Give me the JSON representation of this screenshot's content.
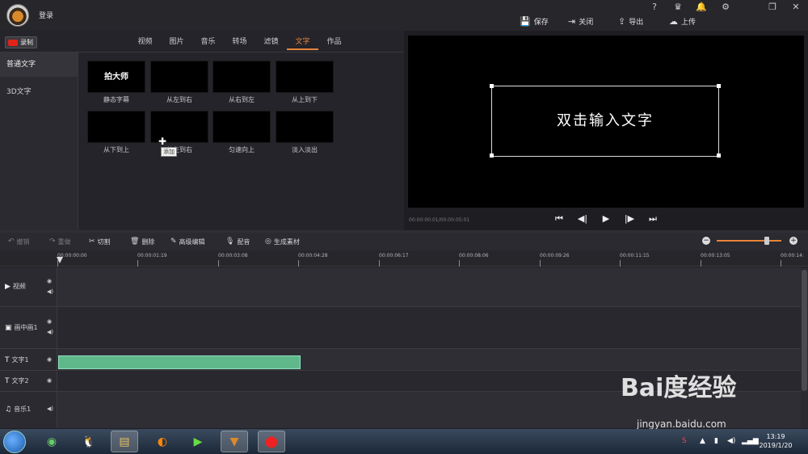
{
  "header": {
    "login_label": "登录",
    "buttons": {
      "save": "保存",
      "close": "关闭",
      "export": "导出",
      "upload": "上传"
    },
    "top_icons": [
      "help-icon",
      "vip-crown-icon",
      "notification-icon",
      "settings-icon",
      "restore-icon",
      "close-icon"
    ]
  },
  "record": {
    "label": "录制"
  },
  "tabs": [
    {
      "label": "视频",
      "active": false
    },
    {
      "label": "图片",
      "active": false
    },
    {
      "label": "音乐",
      "active": false
    },
    {
      "label": "转场",
      "active": false
    },
    {
      "label": "滤镜",
      "active": false
    },
    {
      "label": "文字",
      "active": true
    },
    {
      "label": "作品",
      "active": false
    }
  ],
  "categories": [
    {
      "label": "普通文字",
      "active": true
    },
    {
      "label": "3D文字",
      "active": false
    }
  ],
  "effects": [
    {
      "label": "静态字幕",
      "thumb_text": "拍大师"
    },
    {
      "label": "从左到右",
      "thumb_text": ""
    },
    {
      "label": "从右到左",
      "thumb_text": ""
    },
    {
      "label": "从上到下",
      "thumb_text": ""
    },
    {
      "label": "从下到上",
      "thumb_text": ""
    },
    {
      "label": "从左到右",
      "thumb_text": ""
    },
    {
      "label": "匀速向上",
      "thumb_text": ""
    },
    {
      "label": "淡入淡出",
      "thumb_text": ""
    }
  ],
  "tooltip": "添加",
  "preview": {
    "text": "双击输入文字",
    "timecode": "00:00:00:01/00:00:05:01"
  },
  "toolbar": {
    "undo": "撤销",
    "redo": "重做",
    "cut": "切割",
    "delete": "删除",
    "advanced_edit": "高级编辑",
    "dub": "配音",
    "generate": "生成素材"
  },
  "zoom_level": 0.78,
  "ruler": [
    "00:00:00:00",
    "00:00:01:19",
    "00:00:03:08",
    "00:00:04:28",
    "00:00:06:17",
    "00:00:08:06",
    "00:00:09:26",
    "00:00:11:15",
    "00:00:13:05",
    "00:00:14:"
  ],
  "tracks": [
    {
      "label": "视频",
      "icon": "video-icon"
    },
    {
      "label": "画中画1",
      "icon": "pip-icon"
    },
    {
      "label": "文字1",
      "icon": "text-icon"
    },
    {
      "label": "文字2",
      "icon": "text-icon"
    },
    {
      "label": "音乐1",
      "icon": "music-icon"
    }
  ],
  "watermark": {
    "logo": "Bai度经验",
    "url": "jingyan.baidu.com"
  },
  "taskbar": {
    "time": "13:19",
    "date": "2019/1/20",
    "ime": "S"
  }
}
